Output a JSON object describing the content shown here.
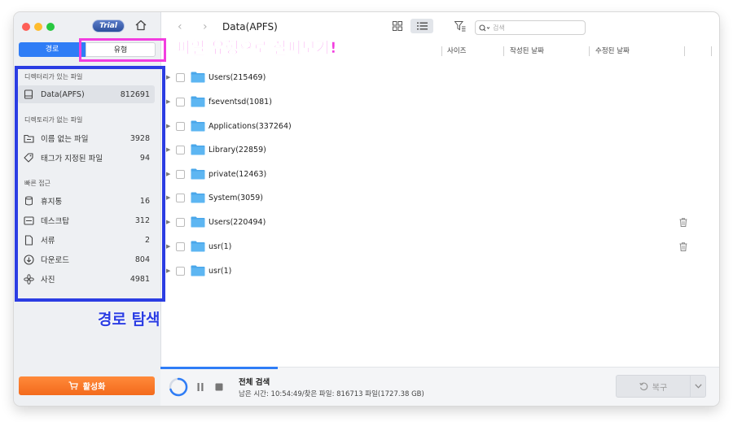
{
  "window": {
    "trial_badge": "Trial",
    "tabs": {
      "path": "경로",
      "type": "유형"
    }
  },
  "sidebar": {
    "section_dir": "디렉터리가 있는 파일",
    "section_nodir": "디렉토리가 없는 파일",
    "section_quick": "빠른 접근",
    "dir_items": [
      {
        "label": "Data(APFS)",
        "count": "812691",
        "icon": "disk-icon"
      }
    ],
    "nodir_items": [
      {
        "label": "이름 없는 파일",
        "count": "3928",
        "icon": "unnamed-folder-icon"
      },
      {
        "label": "태그가 지정된 파일",
        "count": "94",
        "icon": "tag-icon"
      }
    ],
    "quick_items": [
      {
        "label": "휴지통",
        "count": "16",
        "icon": "trash-icon"
      },
      {
        "label": "데스크탑",
        "count": "312",
        "icon": "desktop-icon"
      },
      {
        "label": "서류",
        "count": "2",
        "icon": "document-icon"
      },
      {
        "label": "다운로드",
        "count": "804",
        "icon": "download-icon"
      },
      {
        "label": "사진",
        "count": "4981",
        "icon": "photos-icon"
      }
    ],
    "activate_label": "활성화"
  },
  "toolbar": {
    "title": "Data(APFS)",
    "search_placeholder": "검색"
  },
  "columns": {
    "size": "사이즈",
    "created": "작성된 날짜",
    "modified": "수정된 날짜"
  },
  "files": [
    {
      "name": "Users(215469)",
      "trash": false
    },
    {
      "name": "fseventsd(1081)",
      "trash": false
    },
    {
      "name": "Applications(337264)",
      "trash": false
    },
    {
      "name": "Library(22859)",
      "trash": false
    },
    {
      "name": "private(12463)",
      "trash": false
    },
    {
      "name": "System(3059)",
      "trash": false
    },
    {
      "name": "Users(220494)",
      "trash": true
    },
    {
      "name": "usr(1)",
      "trash": true
    },
    {
      "name": "usr(1)",
      "trash": false
    }
  ],
  "bottom": {
    "scan_title": "전체 검색",
    "scan_status": "남은 시간: 10:54:49/찾은 파일: 816713 파일(1727.38 GB)",
    "recover_label": "복구"
  },
  "annotations": {
    "type_hint": "파일 유형으로 살펴보기!",
    "path_hint": "경로 탐색"
  },
  "colors": {
    "accent": "#2f7df6",
    "activate": "#f36a1c",
    "annotation_pink": "#f23ddf",
    "annotation_blue": "#2b3de3"
  }
}
